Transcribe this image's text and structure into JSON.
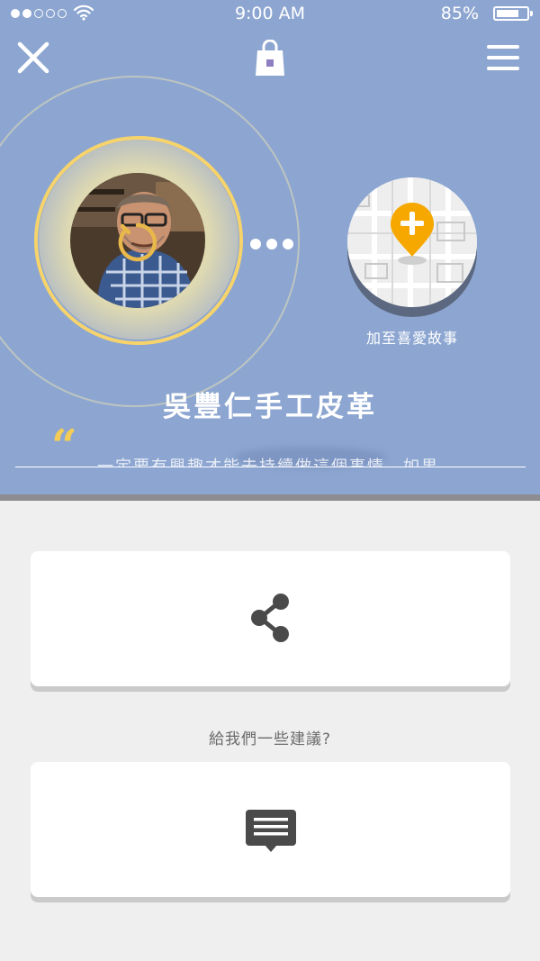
{
  "status_bar": {
    "signal_dots_filled": 2,
    "signal_dots_total": 5,
    "time": "9:00  AM",
    "battery_percent_text": "85%",
    "battery_level": 0.85
  },
  "nav": {
    "close_icon": "close-icon",
    "bag_icon": "shopping-bag-icon",
    "menu_icon": "hamburger-menu-icon"
  },
  "story": {
    "title": "吳豐仁手工皮革",
    "quote_text": "一定要有興趣才能去持續做這個事情，如果",
    "add_favorite_label": "加至喜愛故事"
  },
  "actions": {
    "suggest_label": "給我們一些建議?"
  },
  "colors": {
    "hero_bg": "#8da6d1",
    "accent_gold": "#f7d46b",
    "map_pin": "#f6a800",
    "page_bg": "#efefef",
    "icon_dark": "#4a4a4a"
  }
}
